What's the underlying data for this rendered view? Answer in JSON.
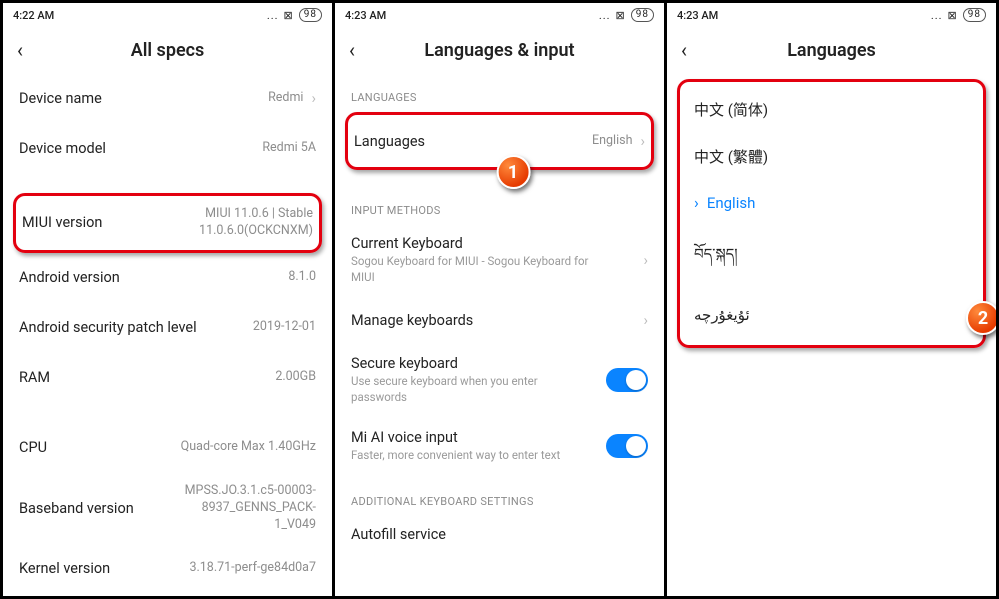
{
  "status": {
    "time1": "4:22 AM",
    "time2": "4:23 AM",
    "time3": "4:23 AM",
    "dots": "...",
    "batt_icon": "⊠",
    "batt": "98"
  },
  "screen1": {
    "title": "All specs",
    "rows": {
      "device_name": {
        "label": "Device name",
        "value": "Redmi"
      },
      "device_model": {
        "label": "Device model",
        "value": "Redmi 5A"
      },
      "miui": {
        "label": "MIUI version",
        "value": "MIUI 11.0.6 | Stable\n11.0.6.0(OCKCNXM)"
      },
      "android": {
        "label": "Android version",
        "value": "8.1.0"
      },
      "patch": {
        "label": "Android security patch level",
        "value": "2019-12-01"
      },
      "ram": {
        "label": "RAM",
        "value": "2.00GB"
      },
      "cpu": {
        "label": "CPU",
        "value": "Quad-core Max 1.40GHz"
      },
      "baseband": {
        "label": "Baseband version",
        "value": "MPSS.JO.3.1.c5-00003-8937_GENNS_PACK-1_V049"
      },
      "kernel": {
        "label": "Kernel version",
        "value": "3.18.71-perf-ge84d0a7"
      }
    }
  },
  "screen2": {
    "title": "Languages & input",
    "section_lang": "LANGUAGES",
    "languages": {
      "label": "Languages",
      "value": "English"
    },
    "section_input": "INPUT METHODS",
    "current_kb": {
      "label": "Current Keyboard",
      "sub": "Sogou Keyboard for MIUI - Sogou Keyboard for MIUI"
    },
    "manage_kb": {
      "label": "Manage keyboards"
    },
    "secure_kb": {
      "label": "Secure keyboard",
      "sub": "Use secure keyboard when you enter passwords"
    },
    "ai_voice": {
      "label": "Mi AI voice input",
      "sub": "Faster, more convenient way to enter text"
    },
    "section_add": "ADDITIONAL KEYBOARD SETTINGS",
    "autofill": {
      "label": "Autofill service"
    },
    "badge": "1"
  },
  "screen3": {
    "title": "Languages",
    "items": [
      "中文 (简体)",
      "中文 (繁體)",
      "English",
      "བོད་སྐད།",
      "ئۇيغۇرچە"
    ],
    "selected_index": 2,
    "badge": "2"
  }
}
